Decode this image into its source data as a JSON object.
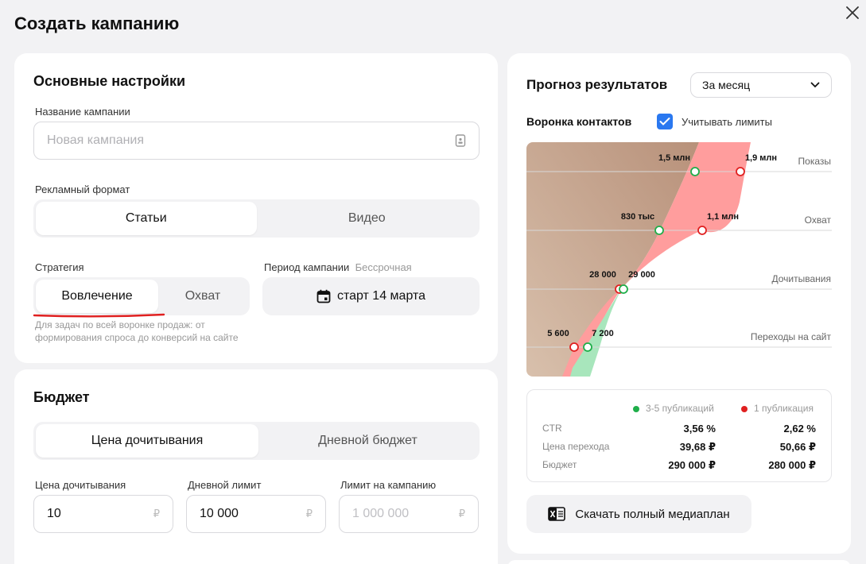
{
  "header": {
    "title": "Создать кампанию"
  },
  "basic": {
    "heading": "Основные настройки",
    "name_label": "Название кампании",
    "name_placeholder": "Новая кампания",
    "format_label": "Рекламный формат",
    "format_options": [
      "Статьи",
      "Видео"
    ],
    "strategy_label": "Стратегия",
    "strategy_options": [
      "Вовлечение",
      "Охват"
    ],
    "strategy_hint_1": "Для задач по всей воронке продаж: от",
    "strategy_hint_2": "формирования спроса до конверсий на сайте",
    "period_label": "Период кампании",
    "period_sub": "Бессрочная",
    "period_button": "старт 14 марта"
  },
  "budget": {
    "heading": "Бюджет",
    "options": [
      "Цена дочитывания",
      "Дневной бюджет"
    ],
    "price_label": "Цена дочитывания",
    "price_value": "10",
    "daily_label": "Дневной лимит",
    "daily_value": "10 000",
    "campaign_label": "Лимит на кампанию",
    "campaign_placeholder": "1 000 000",
    "currency": "₽"
  },
  "forecast": {
    "heading": "Прогноз результатов",
    "period_select": "За месяц",
    "funnel_heading": "Воронка контактов",
    "limits_checkbox": "Учитывать лимиты",
    "levels": [
      {
        "name": "Показы",
        "green": "1,5 млн",
        "red": "1,9 млн"
      },
      {
        "name": "Охват",
        "green": "830 тыс",
        "red": "1,1 млн"
      },
      {
        "name": "Дочитывания",
        "green": "29 000",
        "red": "28 000"
      },
      {
        "name": "Переходы на сайт",
        "green": "7 200",
        "red": "5 600"
      }
    ],
    "legend_green": "3-5 публикаций",
    "legend_red": "1 публикация",
    "rows": [
      {
        "label": "CTR",
        "green": "3,56 %",
        "red": "2,62 %"
      },
      {
        "label": "Цена перехода",
        "green": "39,68 ₽",
        "red": "50,66 ₽"
      },
      {
        "label": "Бюджет",
        "green": "290 000 ₽",
        "red": "280 000 ₽"
      }
    ],
    "download_button": "Скачать полный медиаплан"
  },
  "colors": {
    "green": "#1fae4a",
    "red": "#e02020",
    "accent": "#2a78f0"
  }
}
